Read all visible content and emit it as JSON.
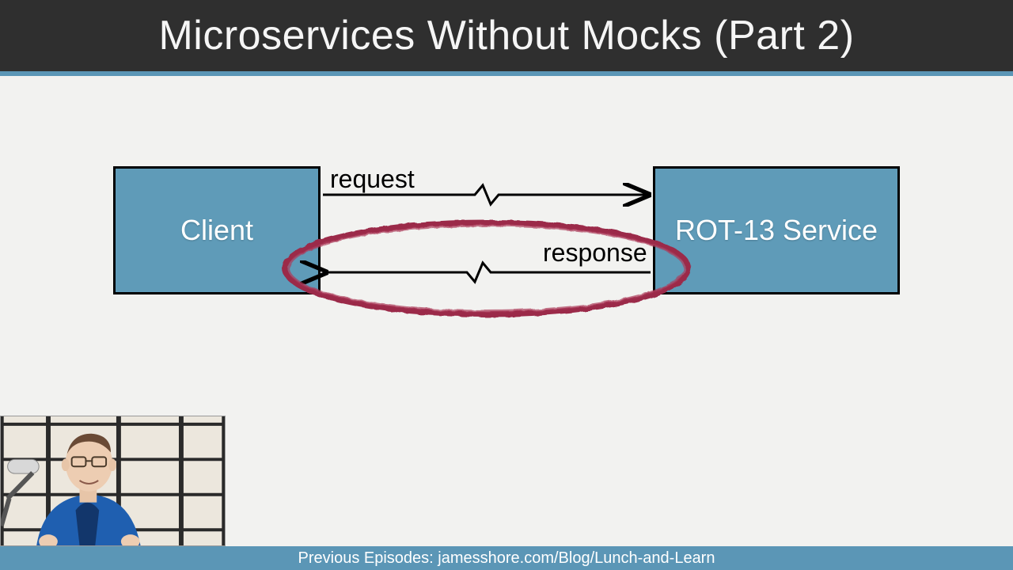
{
  "header": {
    "title": "Microservices Without Mocks (Part 2)"
  },
  "diagram": {
    "left_box": "Client",
    "right_box": "ROT-13 Service",
    "top_arrow_label": "request",
    "bottom_arrow_label": "response",
    "highlight": "response-arrow-circled"
  },
  "footer": {
    "text": "Previous Episodes: jamesshore.com/Blog/Lunch-and-Learn"
  },
  "colors": {
    "header_bg": "#2f2f2f",
    "accent": "#5b96b6",
    "box_fill": "#5f9bb8",
    "circle_stroke": "#9b2a4a"
  },
  "webcam": {
    "description": "presenter-video-thumbnail"
  }
}
